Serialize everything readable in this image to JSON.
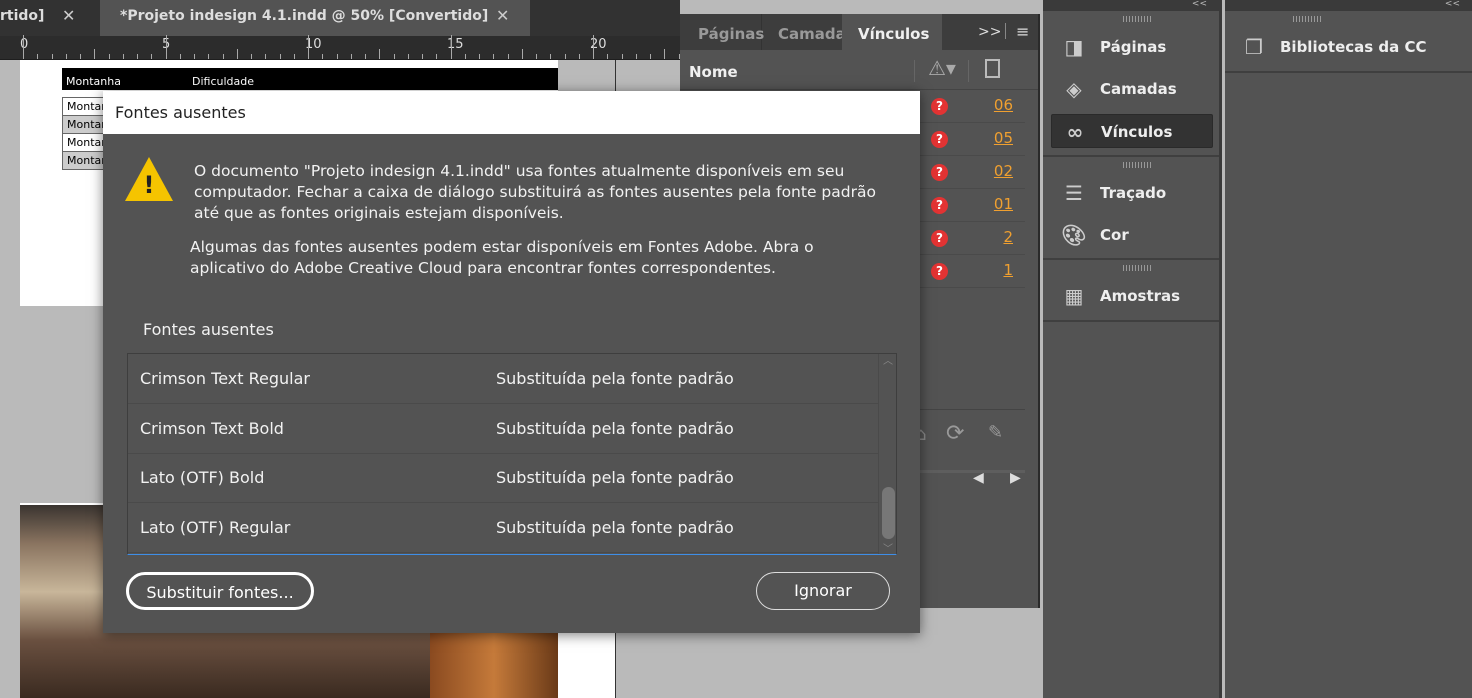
{
  "document_tabs": [
    {
      "label": "rtido]",
      "active": false
    },
    {
      "label": "*Projeto indesign 4.1.indd @ 50% [Convertido]",
      "active": true
    }
  ],
  "ruler": {
    "labels": [
      "0",
      "5",
      "10",
      "15",
      "20"
    ]
  },
  "page_table": {
    "headers": [
      "Montanha",
      "Dificuldade"
    ],
    "rows": [
      "Montar",
      "Montar",
      "Montar",
      "Montar"
    ]
  },
  "links_panel": {
    "tabs": [
      "Páginas",
      "Camada",
      "Vínculos"
    ],
    "active_tab": "Vínculos",
    "overflow": ">>",
    "column_name": "Nome",
    "rows": [
      {
        "status": "missing",
        "page": "06"
      },
      {
        "status": "missing",
        "page": "05"
      },
      {
        "status": "missing",
        "page": "02"
      },
      {
        "status": "missing",
        "page": "01"
      },
      {
        "status": "missing",
        "page": "2"
      },
      {
        "status": "missing",
        "page": "1"
      }
    ],
    "status_color": "#e23333",
    "page_link_color": "#f0a030"
  },
  "dock": {
    "collapse": "<<",
    "items": [
      {
        "label": "Páginas",
        "icon": "pages-icon"
      },
      {
        "label": "Camadas",
        "icon": "layers-icon"
      },
      {
        "label": "Vínculos",
        "icon": "links-icon",
        "selected": true
      },
      {
        "label": "Traçado",
        "icon": "stroke-icon"
      },
      {
        "label": "Cor",
        "icon": "color-palette-icon"
      },
      {
        "label": "Amostras",
        "icon": "swatches-icon"
      }
    ],
    "libraries": "Bibliotecas da CC"
  },
  "dialog": {
    "title": "Fontes ausentes",
    "message1": "O documento \"Projeto indesign 4.1.indd\" usa fontes atualmente disponíveis em seu computador. Fechar a caixa de diálogo substituirá as fontes ausentes pela fonte padrão até que as fontes originais estejam disponíveis.",
    "message2": "Algumas das fontes ausentes podem estar disponíveis em Fontes Adobe. Abra o aplicativo do Adobe Creative Cloud para encontrar fontes correspondentes.",
    "list_label": "Fontes ausentes",
    "fonts": [
      {
        "name": "Crimson Text Regular",
        "status": "Substituída pela fonte padrão"
      },
      {
        "name": "Crimson Text Bold",
        "status": "Substituída pela fonte padrão"
      },
      {
        "name": "Lato (OTF) Bold",
        "status": "Substituída pela fonte padrão"
      },
      {
        "name": "Lato (OTF) Regular",
        "status": "Substituída pela fonte padrão"
      }
    ],
    "replace_button": "Substituir fontes...",
    "ignore_button": "Ignorar",
    "warning_color": "#f5c400"
  }
}
